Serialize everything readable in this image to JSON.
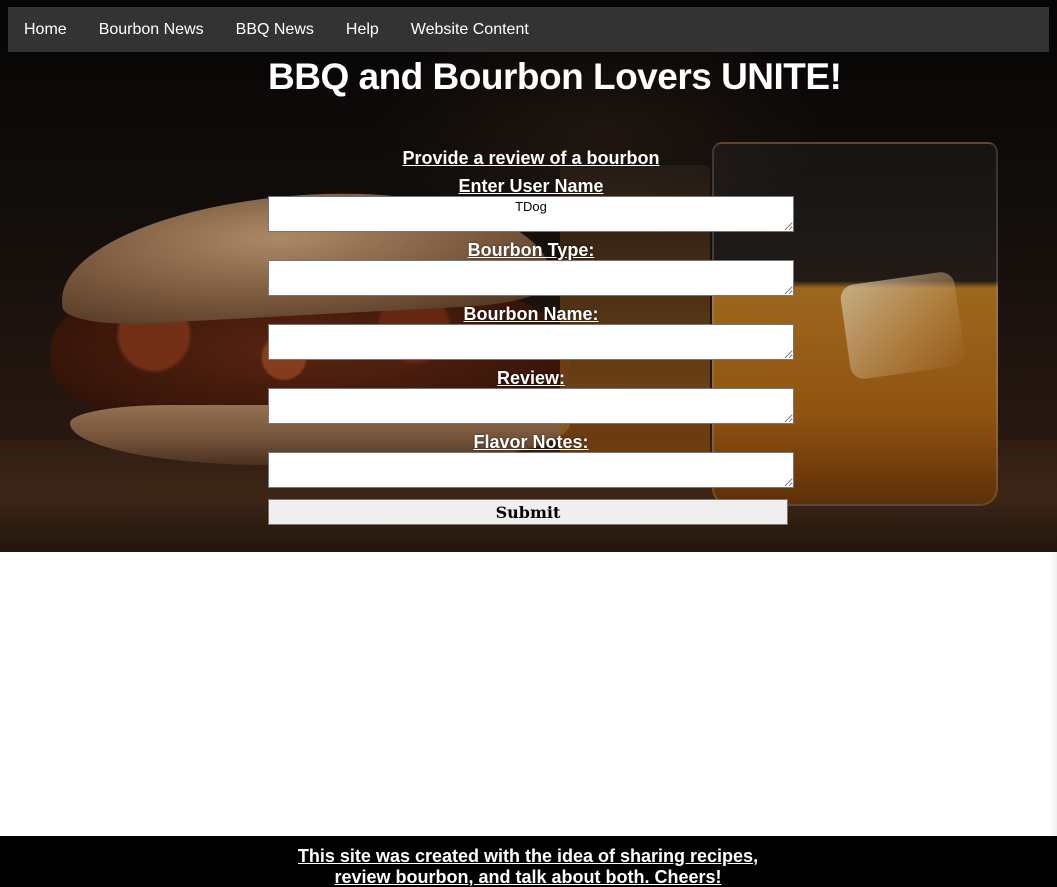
{
  "nav": {
    "items": [
      {
        "label": "Home"
      },
      {
        "label": "Bourbon News"
      },
      {
        "label": "BBQ News"
      },
      {
        "label": "Help"
      },
      {
        "label": "Website Content"
      }
    ]
  },
  "hero": {
    "title": "BBQ and Bourbon Lovers UNITE!",
    "background_description_icon": "bbq-sandwich-and-bourbon-glass-photo"
  },
  "form": {
    "heading": "Provide a review of a bourbon",
    "fields": [
      {
        "label": "Enter User Name",
        "value": "TDog"
      },
      {
        "label": "Bourbon Type:",
        "value": ""
      },
      {
        "label": "Bourbon Name:",
        "value": ""
      },
      {
        "label": "Review:",
        "value": ""
      },
      {
        "label": "Flavor Notes:",
        "value": ""
      }
    ],
    "submit_label": "Submit"
  },
  "footer": {
    "text": "This site was created with the idea of sharing recipes, review bourbon, and talk about both. Cheers!"
  },
  "colors": {
    "navbar_bg": "#333333",
    "footer_bg": "#000000",
    "text_light": "#ffffff",
    "button_bg": "#efefef"
  }
}
